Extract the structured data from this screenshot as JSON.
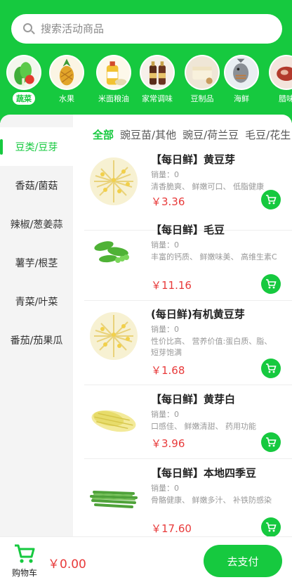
{
  "search": {
    "placeholder": "搜索活动商品"
  },
  "categories": [
    {
      "label": "蔬菜",
      "icon": "vegetables-icon",
      "active": true
    },
    {
      "label": "水果",
      "icon": "pineapple-icon",
      "active": false
    },
    {
      "label": "米面粮油",
      "icon": "oil-bottle-icon",
      "active": false
    },
    {
      "label": "家常调味",
      "icon": "sauce-bottles-icon",
      "active": false
    },
    {
      "label": "豆制品",
      "icon": "tofu-icon",
      "active": false
    },
    {
      "label": "海鲜",
      "icon": "fish-icon",
      "active": false
    },
    {
      "label": "腊味",
      "icon": "cured-meat-icon",
      "active": false
    }
  ],
  "sidebar": {
    "items": [
      {
        "label": "豆类/豆芽",
        "active": true
      },
      {
        "label": "香菇/菌菇",
        "active": false
      },
      {
        "label": "辣椒/葱姜蒜",
        "active": false
      },
      {
        "label": "薯芋/根茎",
        "active": false
      },
      {
        "label": "青菜/叶菜",
        "active": false
      },
      {
        "label": "番茄/茄果瓜",
        "active": false
      }
    ]
  },
  "subtabs": [
    {
      "label": "全部",
      "active": true
    },
    {
      "label": "豌豆苗/其他",
      "active": false
    },
    {
      "label": "豌豆/荷兰豆",
      "active": false
    },
    {
      "label": "毛豆/花生",
      "active": false
    }
  ],
  "products": [
    {
      "title": "【每日鲜】黄豆芽",
      "sales": "销量：0",
      "desc": "清香脆爽、 鲜嫩可口、 低脂健康",
      "price": "￥3.36",
      "image": "bean-sprouts-image"
    },
    {
      "title": "【每日鲜】毛豆",
      "sales": "销量：0",
      "desc": "丰富的钙质、 鲜嫩味美、 高维生素C",
      "price": "￥11.16",
      "image": "edamame-image"
    },
    {
      "title": "(每日鲜)有机黄豆芽",
      "sales": "销量：0",
      "desc": "性价比高、 营养价值:蛋白质、脂、 短芽饱满",
      "price": "￥1.68",
      "image": "bean-sprouts-image"
    },
    {
      "title": "【每日鲜】黄芽白",
      "sales": "销量：0",
      "desc": "口感佳、 鲜嫩清甜、 药用功能",
      "price": "￥3.96",
      "image": "napa-cabbage-image"
    },
    {
      "title": "【每日鲜】本地四季豆",
      "sales": "销量：0",
      "desc": "骨骼健康、 鲜嫩多汁、 补铁防感染",
      "price": "￥17.60",
      "image": "green-beans-image"
    }
  ],
  "cart": {
    "label": "购物车",
    "total": "￥0.00",
    "pay_label": "去支付"
  },
  "colors": {
    "brand": "#16c93f",
    "price": "#e83a3a"
  }
}
